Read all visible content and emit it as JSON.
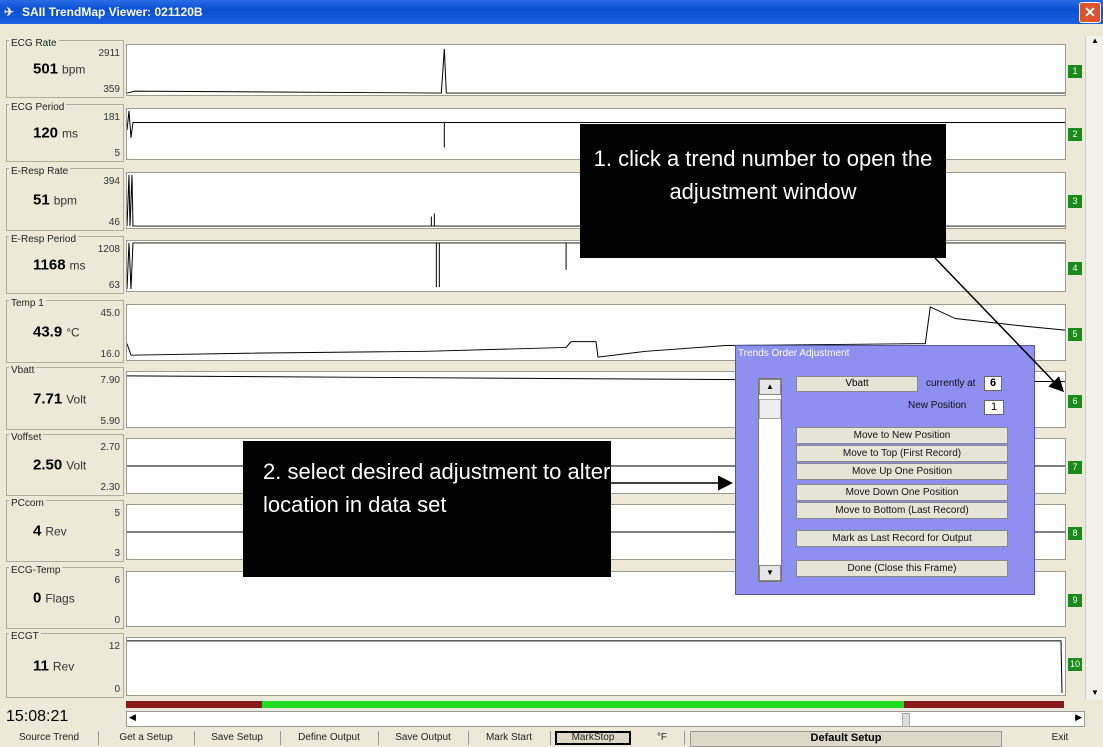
{
  "window": {
    "title": "SAII TrendMap Viewer:  021120B",
    "close_label": "✕"
  },
  "trends": [
    {
      "name": "ECG Rate",
      "max": "2911",
      "min": "359",
      "value": "501",
      "unit": "bpm",
      "number": "1"
    },
    {
      "name": "ECG Period",
      "max": "181",
      "min": "5",
      "value": "120",
      "unit": "ms",
      "number": "2"
    },
    {
      "name": "E-Resp Rate",
      "max": "394",
      "min": "46",
      "value": "51",
      "unit": "bpm",
      "number": "3"
    },
    {
      "name": "E-Resp Period",
      "max": "1208",
      "min": "63",
      "value": "1168",
      "unit": "ms",
      "number": "4"
    },
    {
      "name": "Temp 1",
      "max": "45.0",
      "min": "16.0",
      "value": "43.9",
      "unit": "°C",
      "number": "5"
    },
    {
      "name": "Vbatt",
      "max": "7.90",
      "min": "5.90",
      "value": "7.71",
      "unit": "Volt",
      "number": "6"
    },
    {
      "name": "Voffset",
      "max": "2.70",
      "min": "2.30",
      "value": "2.50",
      "unit": "Volt",
      "number": "7"
    },
    {
      "name": "PCcom",
      "max": "5",
      "min": "3",
      "value": "4",
      "unit": "Rev",
      "number": "8"
    },
    {
      "name": "ECG-Temp",
      "max": "6",
      "min": "0",
      "value": "0",
      "unit": "Flags",
      "number": "9"
    },
    {
      "name": "ECGT",
      "max": "12",
      "min": "0",
      "value": "11",
      "unit": "Rev",
      "number": "10"
    }
  ],
  "time": "15:08:21",
  "toolbar": {
    "buttons": [
      "Source Trend",
      "Get a Setup",
      "Save Setup",
      "Define Output",
      "Save Output",
      "Mark Start",
      "MarkStop",
      "°F"
    ],
    "setup_name": "Default Setup",
    "exit_label": "Exit"
  },
  "dialog": {
    "title": "Trends Order Adjustment",
    "selected_trend": "Vbatt",
    "currently_at_label": "currently at",
    "currently_at_value": "6",
    "new_position_label": "New Position",
    "new_position_value": "1",
    "buttons": {
      "move_new": "Move to New Position",
      "move_top": "Move to Top (First Record)",
      "move_up": "Move Up One Position",
      "move_down": "Move Down One Position",
      "move_bottom": "Move to Bottom (Last Record)",
      "mark_last": "Mark as Last Record for Output",
      "done": "Done (Close this Frame)"
    }
  },
  "callouts": {
    "first": "1. click a trend number to open the adjustment window",
    "second": "2. select desired adjustment to alter location in data set"
  },
  "colors": {
    "titlebar": "#0a4fd4",
    "dialog_bg": "#8f8ff0",
    "trend_number_bg": "#1a8a1a",
    "range_green": "#22dd22",
    "range_red": "#8b1a1a"
  }
}
